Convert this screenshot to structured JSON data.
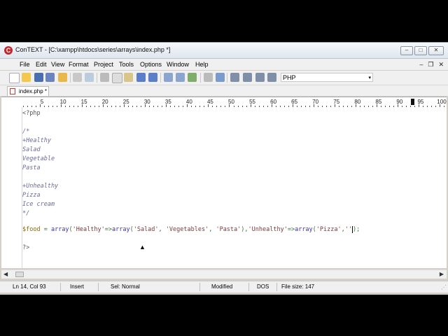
{
  "window": {
    "title": "ConTEXT - [C:\\xampp\\htdocs\\series\\arrays\\index.php *]",
    "app_icon_letter": "C",
    "buttons": {
      "minimize": "–",
      "maximize": "□",
      "close": "✕"
    }
  },
  "menubar": {
    "items": [
      "File",
      "Edit",
      "View",
      "Format",
      "Project",
      "Tools",
      "Options",
      "Window",
      "Help"
    ],
    "mdi": {
      "minimize": "–",
      "restore": "❐",
      "close": "✕"
    }
  },
  "toolbar": {
    "icons": [
      "new-file-icon",
      "open-file-icon",
      "save-icon",
      "save-all-icon",
      "open-folder-icon",
      "print-icon",
      "print-preview-icon",
      "cut-icon",
      "copy-icon",
      "paste-icon",
      "undo-icon",
      "redo-icon",
      "find-icon",
      "find-next-icon",
      "replace-icon",
      "export-icon",
      "settings-icon",
      "macro-1-icon",
      "macro-2-icon",
      "macro-3-icon",
      "macro-4-icon"
    ],
    "highlighter": "PHP",
    "highlighter_arrow": "▾"
  },
  "tabs": [
    {
      "label": "index.php *"
    }
  ],
  "ruler": {
    "labels": [
      "5",
      "10",
      "15",
      "20",
      "25",
      "30",
      "35",
      "40",
      "45",
      "50",
      "55",
      "60",
      "65",
      "70",
      "75",
      "80",
      "85",
      "90",
      "95",
      "100"
    ]
  },
  "code": {
    "open_tag": "<?php",
    "comment_open": "/*",
    "healthy_heading": "+Healthy",
    "healthy_items": [
      "Salad",
      "Vegetable",
      "Pasta"
    ],
    "unhealthy_heading": "+Unhealthy",
    "unhealthy_items": [
      "Pizza",
      "Ice cream"
    ],
    "comment_close": "*/",
    "line_var": "$food",
    "line_eq": " = ",
    "line_array1": "array",
    "line_p1": "(",
    "line_s_healthy": "'Healthy'",
    "line_arrow1": "=>",
    "line_array2": "array",
    "line_p2": "(",
    "line_s_salad": "'Salad'",
    "line_c1": ", ",
    "line_s_veg": "'Vegetables'",
    "line_c2": ", ",
    "line_s_pasta": "'Pasta'",
    "line_p3": "),",
    "line_s_unhealthy": "'Unhealthy'",
    "line_arrow2": "=>",
    "line_array3": "array",
    "line_p4": "(",
    "line_s_pizza": "'Pizza'",
    "line_c3": ",",
    "line_s_empty": "''",
    "line_end": ");",
    "close_tag": "?>"
  },
  "hscroll": {
    "left": "◀",
    "right": "▶"
  },
  "statusbar": {
    "position": "Ln 14, Col 93",
    "mode": "Insert",
    "selection": "Sel: Normal",
    "modified": "Modified",
    "line_ending": "DOS",
    "file_size": "File size: 147",
    "grip": "⋰"
  },
  "colors": {
    "comment": "#6b6b9b",
    "keyword": "#3a2fbf",
    "variable": "#8a6a00",
    "string": "#7a3a3a"
  }
}
